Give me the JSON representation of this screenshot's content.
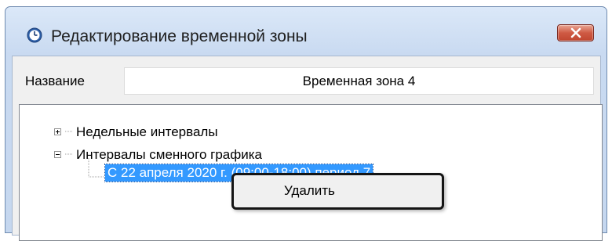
{
  "window": {
    "title": "Редактирование временной зоны",
    "title_icon": "clock-icon",
    "close_icon": "close-icon"
  },
  "form": {
    "name_label": "Название",
    "name_value": "Временная зона 4"
  },
  "tree": {
    "nodes": [
      {
        "label": "Недельные интервалы",
        "expanded": false
      },
      {
        "label": "Интервалы сменного графика",
        "expanded": true,
        "children": [
          {
            "label": "С 22 апреля 2020 г. (09:00-18:00) период 7",
            "selected": true
          }
        ]
      }
    ]
  },
  "context_menu": {
    "items": [
      {
        "label": "Удалить"
      }
    ]
  },
  "colors": {
    "selection": "#3399ff",
    "close_button": "#c9533e",
    "title_bar": "#d2e1f5"
  }
}
